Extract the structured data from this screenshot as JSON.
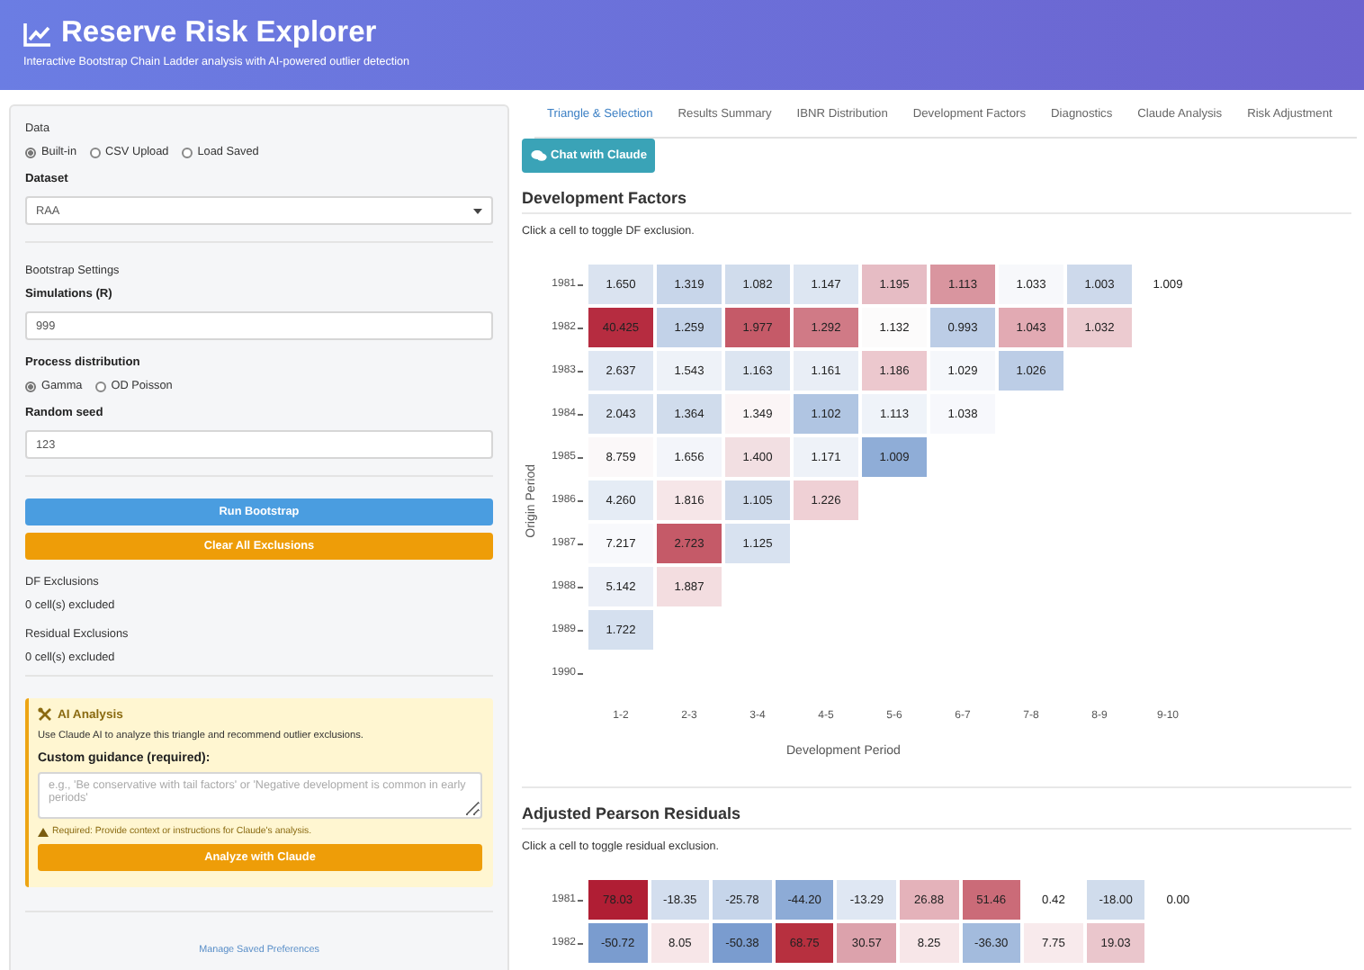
{
  "header": {
    "title": "Reserve Risk Explorer",
    "subtitle": "Interactive Bootstrap Chain Ladder analysis with AI-powered outlier detection"
  },
  "sidebar": {
    "data_label": "Data",
    "data_options": [
      {
        "label": "Built-in",
        "selected": true
      },
      {
        "label": "CSV Upload",
        "selected": false
      },
      {
        "label": "Load Saved",
        "selected": false
      }
    ],
    "dataset": {
      "label": "Dataset",
      "value": "RAA"
    },
    "bootstrap_heading": "Bootstrap Settings",
    "simulations": {
      "label": "Simulations (R)",
      "value": "999"
    },
    "process_label": "Process distribution",
    "process_options": [
      {
        "label": "Gamma",
        "selected": true
      },
      {
        "label": "OD Poisson",
        "selected": false
      }
    ],
    "seed": {
      "label": "Random seed",
      "value": "123"
    },
    "buttons": [
      {
        "label": "Run Bootstrap",
        "kind": "primary"
      },
      {
        "label": "Clear All Exclusions",
        "kind": "warning"
      }
    ],
    "df_exclusions": {
      "label": "DF Exclusions",
      "text": "0 cell(s) excluded"
    },
    "residual_exclusions": {
      "label": "Residual Exclusions",
      "text": "0 cell(s) excluded"
    },
    "ai": {
      "title": "AI Analysis",
      "description": "Use Claude AI to analyze this triangle and recommend outlier exclusions.",
      "guidance_label": "Custom guidance (required):",
      "placeholder": "e.g., 'Be conservative with tail factors' or 'Negative development is common in early periods'",
      "warning": "Required: Provide context or instructions for Claude's analysis.",
      "button": "Analyze with Claude"
    },
    "link": "Manage Saved Preferences"
  },
  "tabs": [
    {
      "label": "Triangle & Selection",
      "selected": true
    },
    {
      "label": "Results Summary",
      "selected": false
    },
    {
      "label": "IBNR Distribution",
      "selected": false
    },
    {
      "label": "Development Factors",
      "selected": false
    },
    {
      "label": "Diagnostics",
      "selected": false
    },
    {
      "label": "Claude Analysis",
      "selected": false
    },
    {
      "label": "Risk Adjustment",
      "selected": false
    }
  ],
  "chat_button": "Chat with Claude",
  "sections": [
    {
      "title": "Development Factors",
      "hint": "Click a cell to toggle DF exclusion.",
      "heatmap": {
        "ylabel": "Origin Period",
        "xlabel": "Development Period",
        "x_labels": [
          "1-2",
          "2-3",
          "3-4",
          "4-5",
          "5-6",
          "6-7",
          "7-8",
          "8-9",
          "9-10"
        ],
        "rows": [
          {
            "label": "1981",
            "cells": [
              {
                "value": "1.650",
                "color": "#dae3f0"
              },
              {
                "value": "1.319",
                "color": "#c8d6ea"
              },
              {
                "value": "1.082",
                "color": "#d0dcec"
              },
              {
                "value": "1.147",
                "color": "#dde6f2"
              },
              {
                "value": "1.195",
                "color": "#e6bcc4"
              },
              {
                "value": "1.113",
                "color": "#d9959f"
              },
              {
                "value": "1.033",
                "color": "#f7f8fb"
              },
              {
                "value": "1.003",
                "color": "#cdd9eb"
              },
              {
                "value": "1.009",
                "color": "#ffffff"
              }
            ]
          },
          {
            "label": "1982",
            "cells": [
              {
                "value": "40.425",
                "color": "#b62c40"
              },
              {
                "value": "1.259",
                "color": "#c2d2e8"
              },
              {
                "value": "1.977",
                "color": "#c55a68"
              },
              {
                "value": "1.292",
                "color": "#d07a86"
              },
              {
                "value": "1.132",
                "color": "#fcfbfb"
              },
              {
                "value": "0.993",
                "color": "#bccde6"
              },
              {
                "value": "1.043",
                "color": "#e2aab3"
              },
              {
                "value": "1.032",
                "color": "#eccbd0"
              }
            ]
          },
          {
            "label": "1983",
            "cells": [
              {
                "value": "2.637",
                "color": "#dfe7f3"
              },
              {
                "value": "1.543",
                "color": "#eef2f8"
              },
              {
                "value": "1.163",
                "color": "#dce5f1"
              },
              {
                "value": "1.161",
                "color": "#e9eef6"
              },
              {
                "value": "1.186",
                "color": "#ecc8ce"
              },
              {
                "value": "1.029",
                "color": "#f5f7fb"
              },
              {
                "value": "1.026",
                "color": "#bccde6"
              }
            ]
          },
          {
            "label": "1984",
            "cells": [
              {
                "value": "2.043",
                "color": "#dbe4f1"
              },
              {
                "value": "1.364",
                "color": "#d0dcec"
              },
              {
                "value": "1.349",
                "color": "#fbf5f6"
              },
              {
                "value": "1.102",
                "color": "#b0c5e2"
              },
              {
                "value": "1.113",
                "color": "#eff3f9"
              },
              {
                "value": "1.038",
                "color": "#f7f8fc"
              }
            ]
          },
          {
            "label": "1985",
            "cells": [
              {
                "value": "8.759",
                "color": "#fbf8f9"
              },
              {
                "value": "1.656",
                "color": "#f3f5fa"
              },
              {
                "value": "1.400",
                "color": "#f2dfe2"
              },
              {
                "value": "1.171",
                "color": "#eef2f8"
              },
              {
                "value": "1.009",
                "color": "#8fadd7"
              }
            ]
          },
          {
            "label": "1986",
            "cells": [
              {
                "value": "4.260",
                "color": "#e5ecf5"
              },
              {
                "value": "1.816",
                "color": "#f6e6e8"
              },
              {
                "value": "1.105",
                "color": "#cedaeb"
              },
              {
                "value": "1.226",
                "color": "#efd0d5"
              }
            ]
          },
          {
            "label": "1987",
            "cells": [
              {
                "value": "7.217",
                "color": "#f8f9fc"
              },
              {
                "value": "2.723",
                "color": "#c55a68"
              },
              {
                "value": "1.125",
                "color": "#d8e2f0"
              }
            ]
          },
          {
            "label": "1988",
            "cells": [
              {
                "value": "5.142",
                "color": "#ebeff7"
              },
              {
                "value": "1.887",
                "color": "#f3dde0"
              }
            ]
          },
          {
            "label": "1989",
            "cells": [
              {
                "value": "1.722",
                "color": "#d5e0ef"
              }
            ]
          },
          {
            "label": "1990"
          }
        ]
      }
    },
    {
      "title": "Adjusted Pearson Residuals",
      "hint": "Click a cell to toggle residual exclusion.",
      "heatmap": {
        "rows": [
          {
            "label": "1981",
            "cells": [
              {
                "value": "78.03",
                "color": "#b01e34"
              },
              {
                "value": "-18.35",
                "color": "#d3deee"
              },
              {
                "value": "-25.78",
                "color": "#c6d5ea"
              },
              {
                "value": "-44.20",
                "color": "#8dabd6"
              },
              {
                "value": "-13.29",
                "color": "#dfe7f3"
              },
              {
                "value": "26.88",
                "color": "#e4b2ba"
              },
              {
                "value": "51.46",
                "color": "#cb6b78"
              },
              {
                "value": "0.42",
                "color": "#ffffff"
              },
              {
                "value": "-18.00",
                "color": "#d0dcec"
              },
              {
                "value": "0.00",
                "color": "#ffffff"
              }
            ]
          },
          {
            "label": "1982",
            "cells": [
              {
                "value": "-50.72",
                "color": "#7a9ccf"
              },
              {
                "value": "8.05",
                "color": "#f7e6e8"
              },
              {
                "value": "-50.38",
                "color": "#7a9ccf"
              },
              {
                "value": "68.75",
                "color": "#b7303f"
              },
              {
                "value": "30.57",
                "color": "#dca2ac"
              },
              {
                "value": "8.25",
                "color": "#f7e6e8"
              },
              {
                "value": "-36.30",
                "color": "#a3bbdd"
              },
              {
                "value": "7.75",
                "color": "#f8eaec"
              },
              {
                "value": "19.03",
                "color": "#eac6cc"
              }
            ]
          }
        ]
      }
    }
  ]
}
